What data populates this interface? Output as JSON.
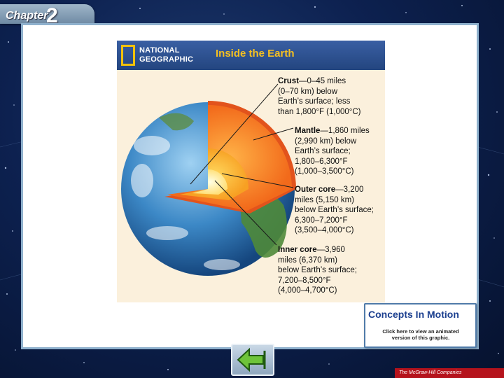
{
  "header": {
    "chapter_word": "Chapter",
    "chapter_number": "2"
  },
  "figure": {
    "brand_line1": "NATIONAL",
    "brand_line2": "GEOGRAPHIC",
    "title": "Inside the Earth",
    "callouts": {
      "crust": {
        "name": "Crust",
        "lines": [
          "—0–45 miles",
          "(0–70 km) below",
          "Earth’s surface; less",
          "than 1,800°F (1,000°C)"
        ]
      },
      "mantle": {
        "name": "Mantle",
        "lines": [
          "—1,860 miles",
          "(2,990 km) below",
          "Earth’s surface;",
          "1,800–6,300°F",
          "(1,000–3,500°C)"
        ]
      },
      "outer_core": {
        "name": "Outer core",
        "lines": [
          "—3,200",
          "miles (5,150 km)",
          "below Earth’s surface;",
          "6,300–7,200°F",
          "(3,500–4,000°C)"
        ]
      },
      "inner_core": {
        "name": "Inner core",
        "lines": [
          "—3,960",
          "miles (6,370 km)",
          "below Earth’s surface;",
          "7,200–8,500°F",
          "(4,000–4,700°C)"
        ]
      }
    }
  },
  "concepts_button": {
    "logo": "Concepts In Motion",
    "caption_line1": "Click here to view an animated",
    "caption_line2": "version of this graphic."
  },
  "publisher": "The McGraw-Hill Companies",
  "colors": {
    "background": "#0d2150",
    "panel_border": "#8fb1cd",
    "header_blue": "#23457f",
    "title_yellow": "#f5c021",
    "crust": "#e7521c",
    "mantle": "#f47a1f",
    "outer_core": "#f9b026",
    "inner_core": "#fff2a8",
    "publisher_red": "#b5131c"
  },
  "icons": {
    "back": "back-arrow-icon"
  }
}
